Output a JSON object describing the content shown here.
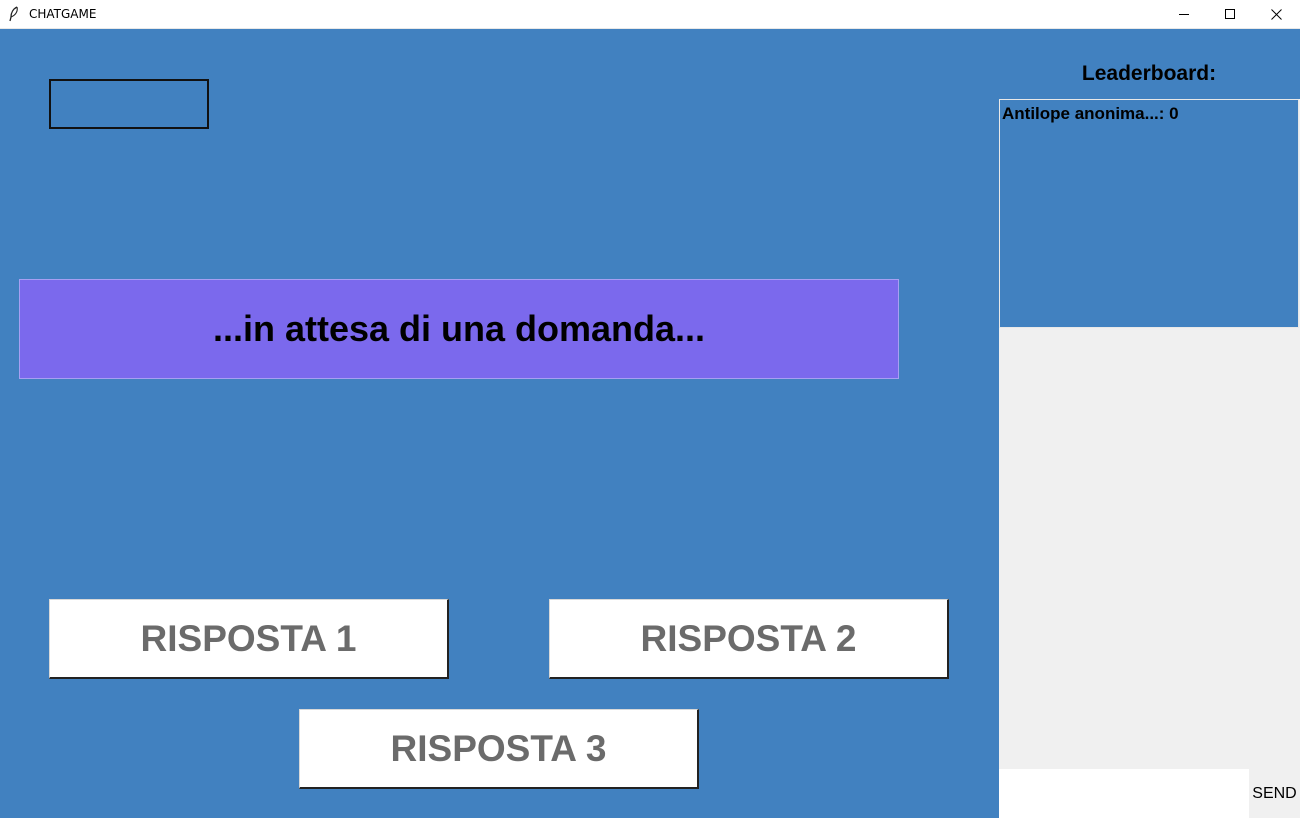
{
  "window": {
    "title": "CHATGAME",
    "icon": "feather-icon"
  },
  "main": {
    "background": "#4181c0",
    "question": "...in attesa di una domanda...",
    "question_color": "#7b69ed",
    "answers": [
      "RISPOSTA 1",
      "RISPOSTA 2",
      "RISPOSTA 3"
    ]
  },
  "leaderboard": {
    "title": "Leaderboard:",
    "entries": [
      "Antilope anonima...: 0"
    ]
  },
  "chat": {
    "input_value": "",
    "send_label": "SEND"
  }
}
